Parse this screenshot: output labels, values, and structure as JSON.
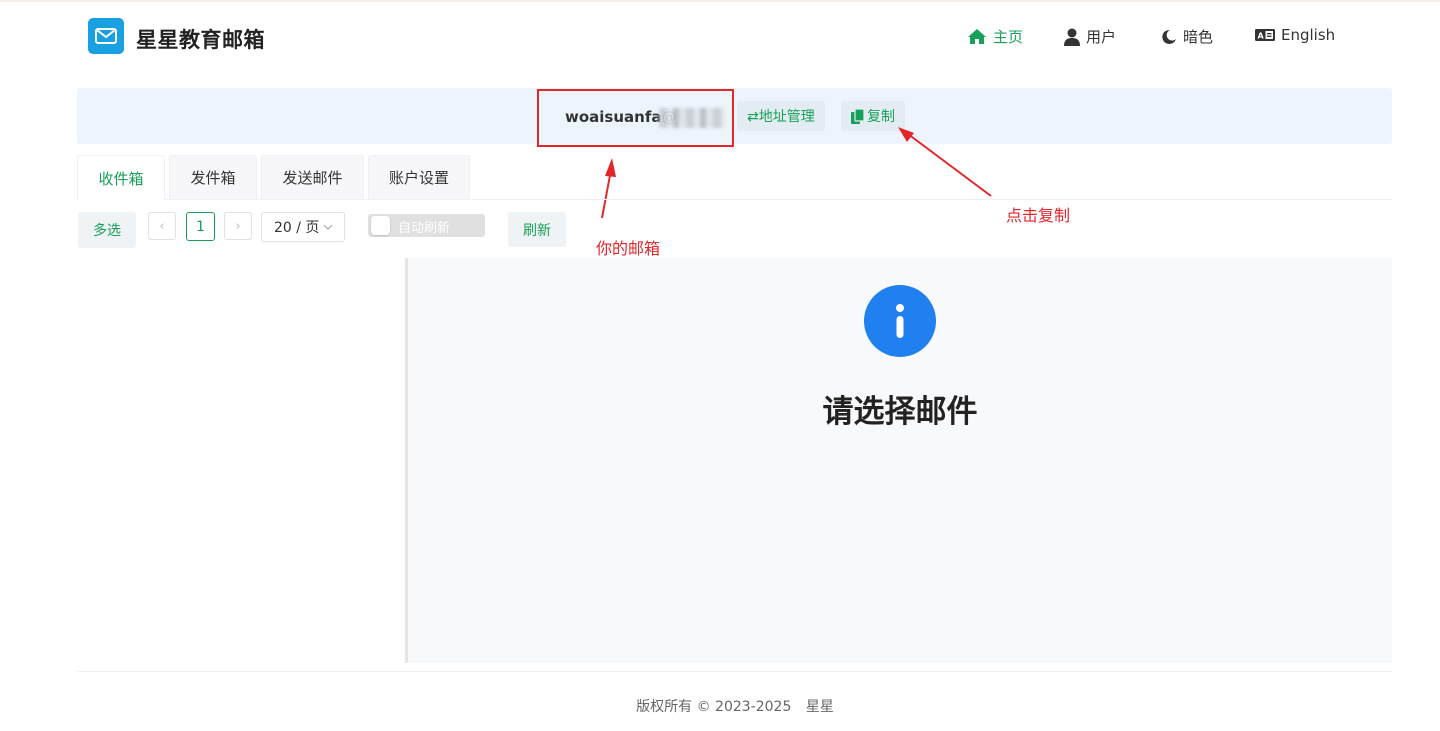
{
  "app": {
    "title": "星星教育邮箱",
    "logo_icon": "mail-icon",
    "brand_color": "#18a0e0",
    "accent_color": "#18a058"
  },
  "nav": {
    "home": "主页",
    "user": "用户",
    "dark": "暗色",
    "language": "English"
  },
  "address": {
    "email_prefix": "woaisuanfa@",
    "manage_label": "⇄地址管理",
    "copy_label": "复制"
  },
  "tabs": [
    {
      "label": "收件箱",
      "active": true
    },
    {
      "label": "发件箱",
      "active": false
    },
    {
      "label": "发送邮件",
      "active": false
    },
    {
      "label": "账户设置",
      "active": false
    }
  ],
  "toolbar": {
    "multi_select": "多选",
    "prev": "‹",
    "page": "1",
    "next": "›",
    "page_size": "20 / 页",
    "auto_refresh": "自动刷新",
    "auto_refresh_on": false,
    "refresh": "刷新"
  },
  "annotations": {
    "your_mailbox": "你的邮箱",
    "click_copy": "点击复制",
    "color": "#e3262a"
  },
  "detail": {
    "empty_icon": "info-icon",
    "empty_title": "请选择邮件"
  },
  "footer": {
    "text": "版权所有 © 2023-2025",
    "owner": "星星"
  }
}
